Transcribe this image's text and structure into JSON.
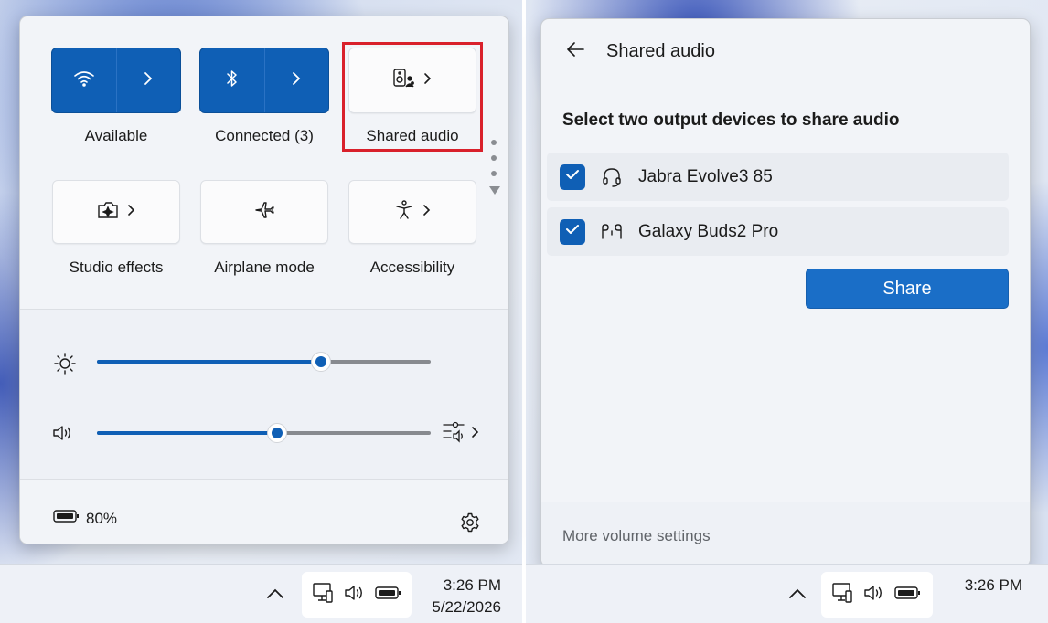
{
  "quick_settings": {
    "tiles": [
      {
        "label": "Available",
        "icon": "wifi-icon",
        "state": "on"
      },
      {
        "label": "Connected (3)",
        "icon": "bluetooth-icon",
        "state": "on"
      },
      {
        "label": "Shared audio",
        "icon": "shared-audio-icon",
        "state": "off"
      },
      {
        "label": "Studio effects",
        "icon": "studio-effects-icon",
        "state": "off"
      },
      {
        "label": "Airplane mode",
        "icon": "airplane-icon",
        "state": "off"
      },
      {
        "label": "Accessibility",
        "icon": "accessibility-icon",
        "state": "off"
      }
    ],
    "brightness": {
      "icon": "sun-icon",
      "level_fraction": 0.67
    },
    "volume": {
      "icon": "speaker-icon",
      "level_fraction": 0.54
    },
    "battery": {
      "percent": "80%",
      "icon": "battery-icon"
    },
    "settings_icon": "gear-icon",
    "highlight_color": "#d9202b",
    "accent_color": "#0f5fb5"
  },
  "shared_audio_panel": {
    "title": "Shared audio",
    "instruction": "Select two output devices to share audio",
    "devices": [
      {
        "name": "Jabra Evolve3 85",
        "icon": "headset-icon",
        "checked": true
      },
      {
        "name": "Galaxy Buds2 Pro",
        "icon": "earbuds-icon",
        "checked": true
      }
    ],
    "share_label": "Share",
    "more_volume_label": "More volume settings"
  },
  "taskbar_left": {
    "time": "3:26 PM",
    "date": "5/22/2026"
  },
  "taskbar_right": {
    "time": "3:26 PM"
  }
}
